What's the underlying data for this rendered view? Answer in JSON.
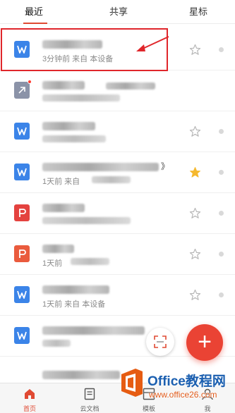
{
  "tabs": {
    "recent": "最近",
    "shared": "共享",
    "starred": "星标"
  },
  "files": [
    {
      "icon": "word-doc-icon",
      "title_visible": "",
      "meta": "3分钟前    来自 本设备",
      "starred": false
    },
    {
      "icon": "link-file-icon",
      "title_visible": "",
      "meta": "",
      "starred": false,
      "badge": true
    },
    {
      "icon": "word-doc-icon",
      "title_visible": "",
      "meta": "",
      "starred": false
    },
    {
      "icon": "word-doc-icon",
      "title_visible": "》",
      "meta": "1天前    来自",
      "starred": true
    },
    {
      "icon": "pdf-doc-icon",
      "title_visible": "",
      "meta": "",
      "starred": false
    },
    {
      "icon": "ppt-doc-icon",
      "title_visible": "",
      "meta": "1天前",
      "starred": false
    },
    {
      "icon": "word-doc-icon",
      "title_visible": "",
      "meta": "1天前    来自 本设备",
      "starred": false
    },
    {
      "icon": "word-doc-icon",
      "title_visible": "",
      "meta": "",
      "starred": false
    }
  ],
  "bottom_nav": {
    "home": "首页",
    "cloud_docs": "云文档",
    "templates": "模板",
    "me": "我"
  },
  "watermark": {
    "brand": "Office教程网",
    "url": "www.office26.com"
  },
  "colors": {
    "accent": "#e04a33",
    "word": "#3b84e8",
    "pdf": "#e4423f",
    "ppt": "#ea5b3d",
    "star": "#f5b82e"
  }
}
